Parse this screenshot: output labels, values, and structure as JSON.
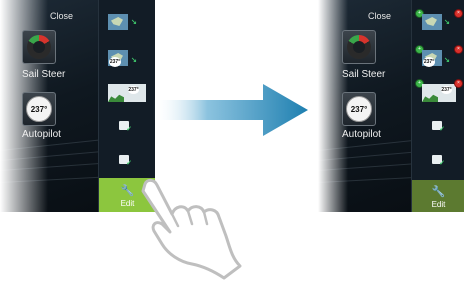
{
  "before": {
    "close_label": "Close",
    "apps": [
      {
        "label": "Sail Steer"
      },
      {
        "label": "Autopilot",
        "dial_value": "237°"
      }
    ],
    "strip_thumb_value": "237°",
    "edit_label": "Edit"
  },
  "after": {
    "close_label": "Close",
    "apps": [
      {
        "label": "Sail Steer"
      },
      {
        "label": "Autopilot",
        "dial_value": "237°"
      }
    ],
    "strip_thumb_value": "237°",
    "edit_label": "Edit"
  },
  "colors": {
    "edit_active": "#8cc63e",
    "edit_inactive": "#5c7a30",
    "arrow": "#1e7fb0",
    "badge_add": "#3cb54a",
    "badge_remove": "#d9302b"
  },
  "icons": [
    "wrench-icon",
    "sail-steer-icon",
    "autopilot-dial-icon",
    "chart-thumb-icon",
    "hand-gesture-icon",
    "right-arrow-icon"
  ]
}
